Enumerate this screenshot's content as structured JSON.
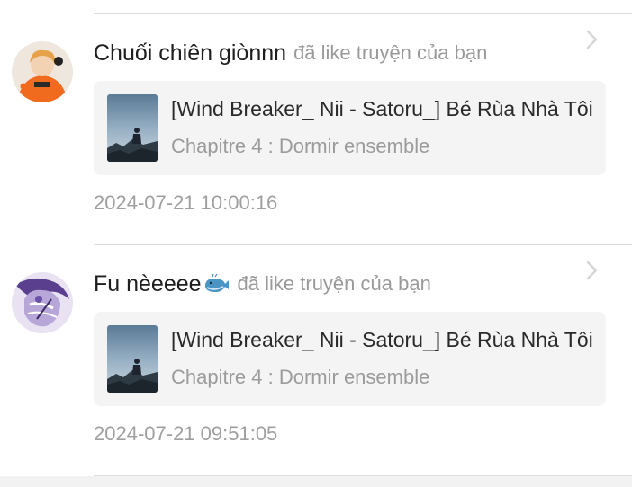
{
  "notifications": [
    {
      "username": "Chuối chiên giònnn",
      "has_emoji": false,
      "action_text": "đã like truyện của bạn",
      "story_title": "[Wind Breaker_ Nii - Satoru_] Bé Rùa Nhà Tôi",
      "chapter": "Chapitre 4 : Dormir ensemble",
      "timestamp": "2024-07-21 10:00:16",
      "avatar_icon": "orange-hoodie-avatar",
      "chevron_icon": "chevron-right-icon"
    },
    {
      "username": "Fu nèeeee",
      "has_emoji": true,
      "emoji_icon": "whale-emoji-icon",
      "action_text": "đã like truyện của bạn",
      "story_title": "[Wind Breaker_ Nii - Satoru_] Bé Rùa Nhà Tôi",
      "chapter": "Chapitre 4 : Dormir ensemble",
      "timestamp": "2024-07-21 09:51:05",
      "avatar_icon": "purple-anime-avatar",
      "chevron_icon": "chevron-right-icon"
    }
  ],
  "colors": {
    "username": "#1e1e1e",
    "action": "#9a9a9a",
    "card_bg": "#f4f4f5",
    "divider": "#dcdcdc",
    "timestamp": "#9f9f9f"
  }
}
